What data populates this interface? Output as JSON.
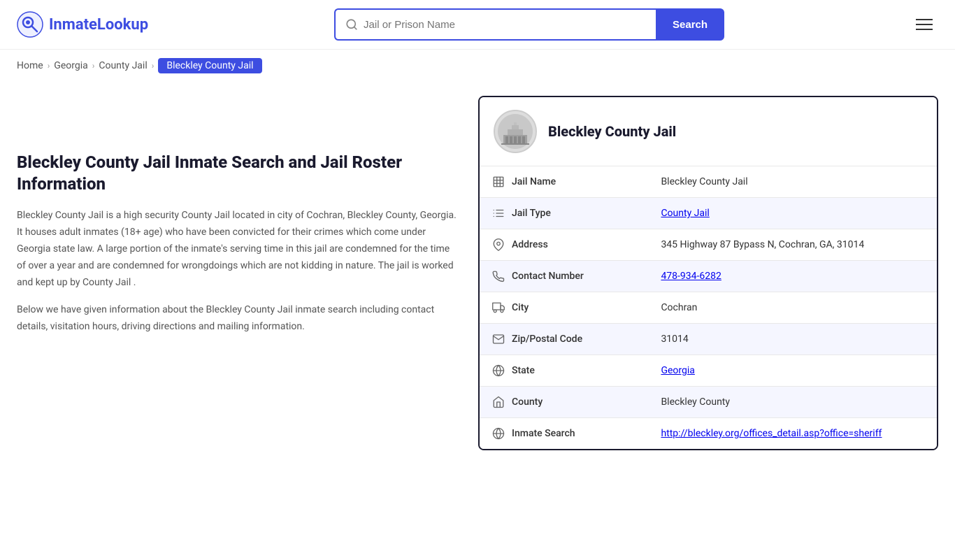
{
  "header": {
    "logo_text_first": "Inmate",
    "logo_text_second": "Lookup",
    "search_placeholder": "Jail or Prison Name",
    "search_button_label": "Search"
  },
  "breadcrumb": {
    "items": [
      {
        "label": "Home",
        "href": "#"
      },
      {
        "label": "Georgia",
        "href": "#"
      },
      {
        "label": "County Jail",
        "href": "#"
      },
      {
        "label": "Bleckley County Jail",
        "current": true
      }
    ]
  },
  "left": {
    "title": "Bleckley County Jail Inmate Search and Jail Roster Information",
    "desc1": "Bleckley County Jail is a high security County Jail located in city of Cochran, Bleckley County, Georgia. It houses adult inmates (18+ age) who have been convicted for their crimes which come under Georgia state law. A large portion of the inmate's serving time in this jail are condemned for the time of over a year and are condemned for wrongdoings which are not kidding in nature. The jail is worked and kept up by County Jail .",
    "desc2": "Below we have given information about the Bleckley County Jail inmate search including contact details, visitation hours, driving directions and mailing information."
  },
  "card": {
    "title": "Bleckley County Jail",
    "rows": [
      {
        "icon": "building-icon",
        "label": "Jail Name",
        "value": "Bleckley County Jail",
        "link": null
      },
      {
        "icon": "list-icon",
        "label": "Jail Type",
        "value": "County Jail",
        "link": "#"
      },
      {
        "icon": "pin-icon",
        "label": "Address",
        "value": "345 Highway 87 Bypass N, Cochran, GA, 31014",
        "link": null
      },
      {
        "icon": "phone-icon",
        "label": "Contact Number",
        "value": "478-934-6282",
        "link": "tel:478-934-6282"
      },
      {
        "icon": "city-icon",
        "label": "City",
        "value": "Cochran",
        "link": null
      },
      {
        "icon": "mail-icon",
        "label": "Zip/Postal Code",
        "value": "31014",
        "link": null
      },
      {
        "icon": "globe-icon",
        "label": "State",
        "value": "Georgia",
        "link": "#"
      },
      {
        "icon": "county-icon",
        "label": "County",
        "value": "Bleckley County",
        "link": null
      },
      {
        "icon": "search-globe-icon",
        "label": "Inmate Search",
        "value": "http://bleckley.org/offices_detail.asp?office=sheriff",
        "link": "http://bleckley.org/offices_detail.asp?office=sheriff"
      }
    ]
  }
}
